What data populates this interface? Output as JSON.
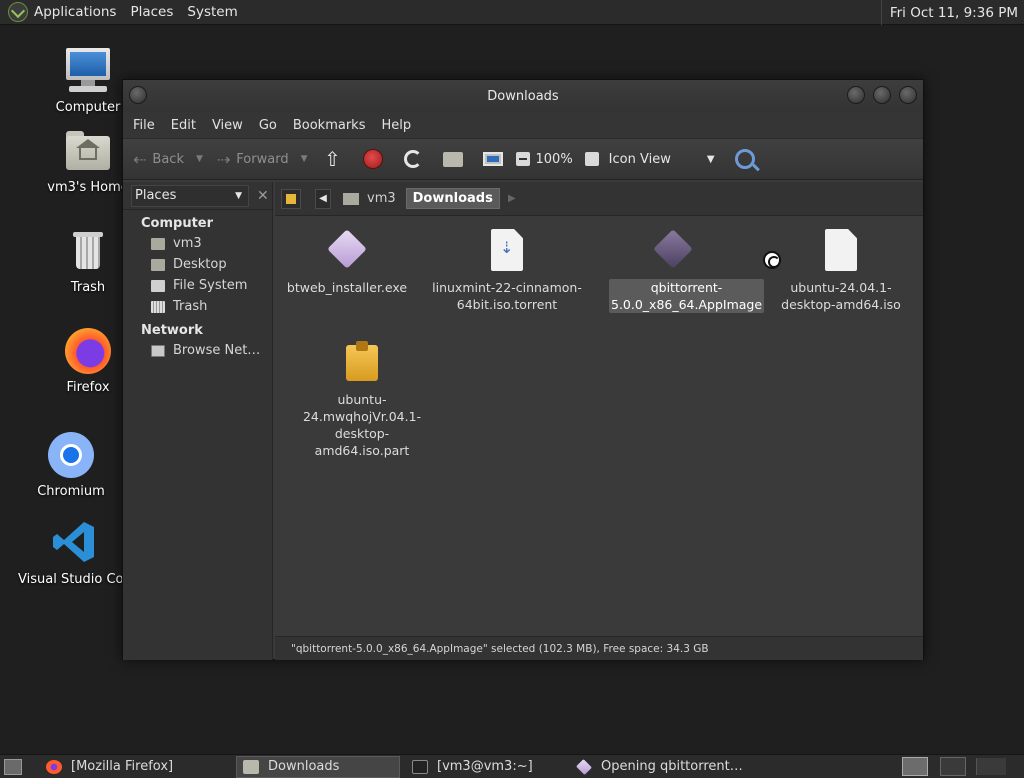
{
  "top_panel": {
    "menus": [
      "Applications",
      "Places",
      "System"
    ],
    "clock": "Fri Oct 11,  9:36 PM"
  },
  "desktop_icons": [
    {
      "label": "Computer"
    },
    {
      "label": "vm3's Home"
    },
    {
      "label": "Trash"
    },
    {
      "label": "Firefox"
    },
    {
      "label": "Chromium"
    },
    {
      "label": "Visual Studio Code"
    }
  ],
  "window": {
    "title": "Downloads",
    "menu": [
      "File",
      "Edit",
      "View",
      "Go",
      "Bookmarks",
      "Help"
    ],
    "toolbar": {
      "back": "Back",
      "forward": "Forward",
      "zoom": "100%",
      "view_mode": "Icon View"
    },
    "sidebar": {
      "selector": "Places",
      "sections": [
        {
          "title": "Computer",
          "items": [
            "vm3",
            "Desktop",
            "File System",
            "Trash"
          ]
        },
        {
          "title": "Network",
          "items": [
            "Browse Net…"
          ]
        }
      ]
    },
    "breadcrumb": [
      "vm3",
      "Downloads"
    ],
    "files": [
      {
        "name": "btweb_installer.exe",
        "type": "exe"
      },
      {
        "name": "linuxmint-22-cinnamon-64bit.iso.torrent",
        "type": "torrent"
      },
      {
        "name": "qbittorrent-5.0.0_x86_64.AppImage",
        "type": "appimage",
        "selected": true
      },
      {
        "name": "ubuntu-24.04.1-desktop-amd64.iso",
        "type": "iso"
      },
      {
        "name": "ubuntu-24.mwqhojVr.04.1-desktop-amd64.iso.part",
        "type": "part"
      }
    ],
    "status": "\"qbittorrent-5.0.0_x86_64.AppImage\" selected (102.3 MB), Free space: 34.3 GB"
  },
  "taskbar": {
    "tasks": [
      {
        "label": "[Mozilla Firefox]",
        "icon": "firefox-icon",
        "active": false
      },
      {
        "label": "Downloads",
        "icon": "folder-icon",
        "active": true
      },
      {
        "label": "[vm3@vm3:~]",
        "icon": "terminal-icon",
        "active": false
      },
      {
        "label": "Opening qbittorrent…",
        "icon": "qbittorrent-icon",
        "active": false
      }
    ]
  },
  "colors": {
    "desktop_bg": "#1f1f1f",
    "panel_bg": "#2b2b2b",
    "window_bg": "#3a3a3a",
    "selection": "#5b5b5b"
  }
}
